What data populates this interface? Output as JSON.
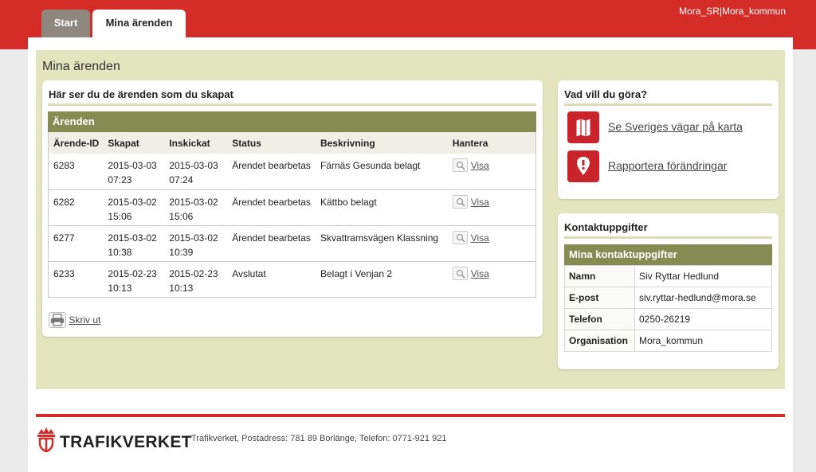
{
  "header": {
    "user": "Mora_SR|Mora_kommun",
    "tabs": [
      "Start",
      "Mina ärenden"
    ]
  },
  "page": {
    "title": "Mina ärenden"
  },
  "cases": {
    "heading": "Här ser du de ärenden som du skapat",
    "table_title": "Ärenden",
    "columns": [
      "Ärende-ID",
      "Skapat",
      "Inskickat",
      "Status",
      "Beskrivning",
      "Hantera"
    ],
    "rows": [
      {
        "id": "6283",
        "skapat_date": "2015-03-03",
        "skapat_time": "07:23",
        "inskickat_date": "2015-03-03",
        "inskickat_time": "07:24",
        "status": "Ärendet bearbetas",
        "beskrivning": "Färnäs Gesunda belagt",
        "action": "Visa"
      },
      {
        "id": "6282",
        "skapat_date": "2015-03-02",
        "skapat_time": "15:06",
        "inskickat_date": "2015-03-02",
        "inskickat_time": "15:06",
        "status": "Ärendet bearbetas",
        "beskrivning": "Kättbo belagt",
        "action": "Visa"
      },
      {
        "id": "6277",
        "skapat_date": "2015-03-02",
        "skapat_time": "10:38",
        "inskickat_date": "2015-03-02",
        "inskickat_time": "10:39",
        "status": "Ärendet bearbetas",
        "beskrivning": "Skvattramsvägen Klassning",
        "action": "Visa"
      },
      {
        "id": "6233",
        "skapat_date": "2015-02-23",
        "skapat_time": "10:13",
        "inskickat_date": "2015-02-23",
        "inskickat_time": "10:13",
        "status": "Avslutat",
        "beskrivning": "Belagt i Venjan 2",
        "action": "Visa"
      }
    ],
    "print_label": "Skriv ut"
  },
  "actions": {
    "heading": "Vad vill du göra?",
    "items": [
      {
        "label": "Se Sveriges vägar på karta",
        "icon": "map-icon"
      },
      {
        "label": "Rapportera förändringar",
        "icon": "map-pin-icon"
      }
    ]
  },
  "contact": {
    "heading": "Kontaktuppgifter",
    "table_title": "Mina kontaktuppgifter",
    "rows": [
      {
        "key": "Namn",
        "value": "Siv Ryttar Hedlund"
      },
      {
        "key": "E-post",
        "value": "siv.ryttar-hedlund@mora.se"
      },
      {
        "key": "Telefon",
        "value": "0250-26219"
      },
      {
        "key": "Organisation",
        "value": "Mora_kommun"
      }
    ]
  },
  "footer": {
    "logo": "TRAFIKVERKET",
    "text": "Trafikverket, Postadress: 781 89 Borlänge, Telefon: 0771-921 921"
  },
  "colors": {
    "brand_red": "#d42d27",
    "olive_header": "#858c52",
    "olive_bg": "#e2e5be",
    "tab_gray": "#8f877e"
  }
}
